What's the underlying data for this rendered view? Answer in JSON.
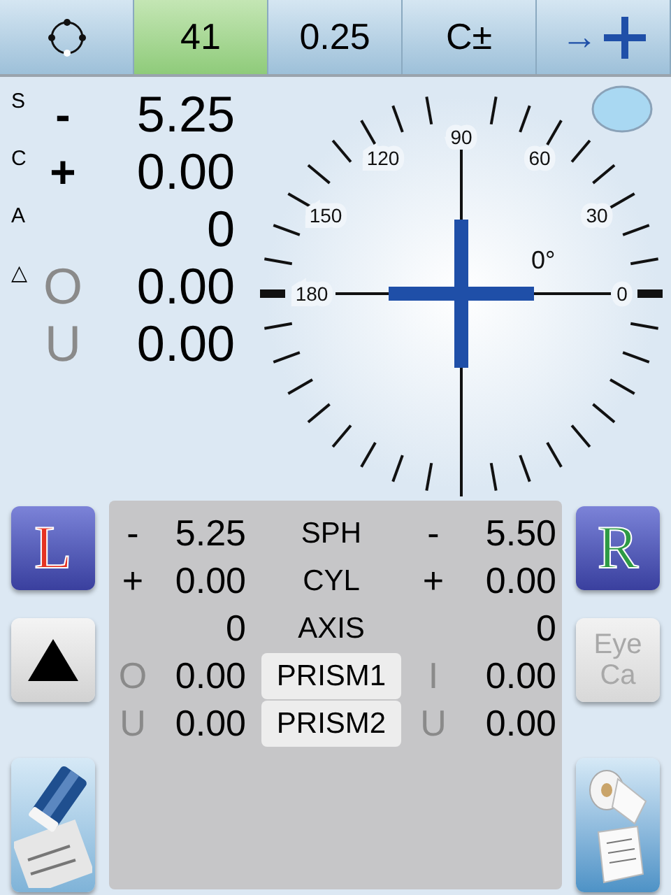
{
  "tabs": [
    {
      "kind": "icon",
      "selected": false
    },
    {
      "kind": "text",
      "label": "41",
      "selected": true
    },
    {
      "kind": "text",
      "label": "0.25",
      "selected": false
    },
    {
      "kind": "text",
      "label": "C±",
      "selected": false
    },
    {
      "kind": "add",
      "label": "→",
      "selected": false
    }
  ],
  "readings": [
    {
      "label": "S",
      "prefix": "-",
      "dimmed": false,
      "value": "5.25"
    },
    {
      "label": "C",
      "prefix": "+",
      "dimmed": false,
      "value": "0.00"
    },
    {
      "label": "A",
      "value": "0"
    },
    {
      "label": "△",
      "prefix": "O",
      "dimmed": true,
      "value": "0.00"
    },
    {
      "prefix": "U",
      "dimmed": true,
      "value": "0.00"
    }
  ],
  "dial": {
    "labels": [
      "0",
      "30",
      "60",
      "90",
      "120",
      "150",
      "180"
    ],
    "reading": "0°"
  },
  "compare": [
    {
      "kind": "text",
      "label": "SPH",
      "left_prefix": "-",
      "left_value": "5.25",
      "right_prefix": "-",
      "right_value": "5.50",
      "dimmed": false
    },
    {
      "kind": "text",
      "label": "CYL",
      "left_prefix": "+",
      "left_value": "0.00",
      "right_prefix": "+",
      "right_value": "0.00",
      "dimmed": false
    },
    {
      "kind": "text",
      "label": "AXIS",
      "left_value": "0",
      "right_value": "0"
    },
    {
      "kind": "button",
      "label": "PRISM1",
      "left_prefix": "O",
      "left_value": "0.00",
      "right_prefix": "I",
      "right_value": "0.00",
      "dimmed": true
    },
    {
      "kind": "button",
      "label": "PRISM2",
      "left_prefix": "U",
      "left_value": "0.00",
      "right_prefix": "U",
      "right_value": "0.00",
      "dimmed": true
    }
  ],
  "left_buttons": [
    {
      "kind": "L",
      "label": "L"
    },
    {
      "kind": "triangle"
    },
    {
      "kind": "eraser"
    }
  ],
  "right_buttons": [
    {
      "kind": "R",
      "label": "R"
    },
    {
      "kind": "text",
      "label": "Eye Ca",
      "disabled": true
    },
    {
      "kind": "printer"
    }
  ]
}
